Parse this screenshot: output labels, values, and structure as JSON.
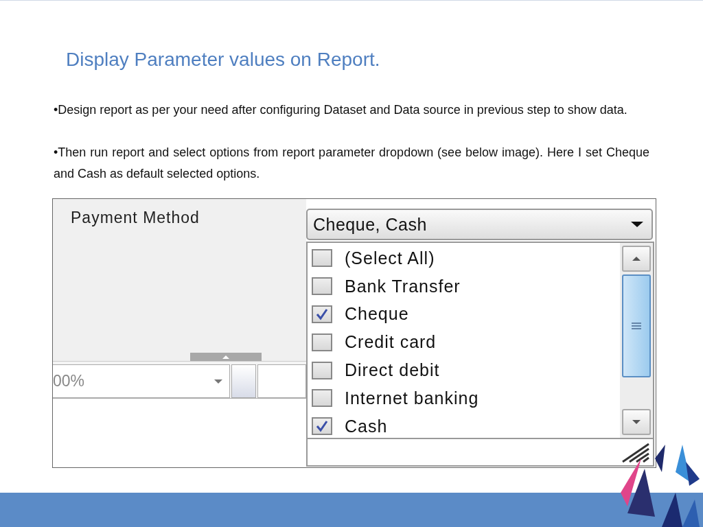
{
  "slide": {
    "title": "Display Parameter values on Report.",
    "bullets": [
      "•Design report as per your need after configuring Dataset and Data source in previous step to show data.",
      "•Then run report and select options from report parameter dropdown (see below image). Here I set Cheque and Cash as default selected options."
    ]
  },
  "report_viewer": {
    "parameter_label": "Payment Method",
    "dropdown": {
      "value": "Cheque, Cash"
    },
    "options": [
      {
        "label": "(Select All)",
        "checked": false
      },
      {
        "label": "Bank Transfer",
        "checked": false
      },
      {
        "label": "Cheque",
        "checked": true
      },
      {
        "label": "Credit card",
        "checked": false
      },
      {
        "label": "Direct debit",
        "checked": false
      },
      {
        "label": "Internet banking",
        "checked": false
      },
      {
        "label": "Cash",
        "checked": true
      }
    ],
    "zoom": {
      "value": "00%"
    }
  }
}
